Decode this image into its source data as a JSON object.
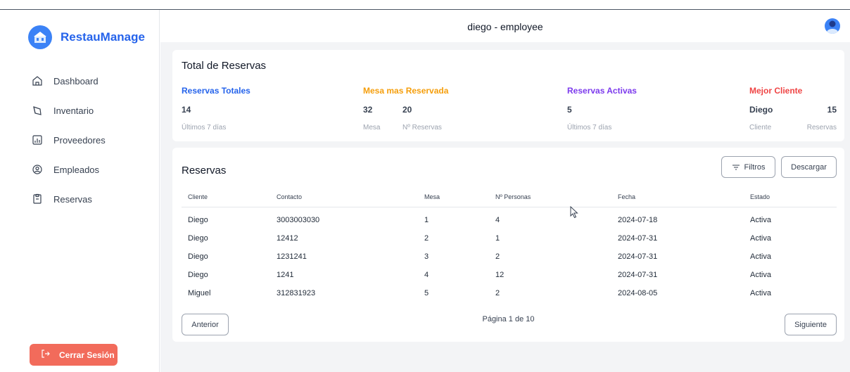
{
  "header": {
    "title": "diego - employee"
  },
  "sidebar": {
    "brand": "RestauManage",
    "items": [
      {
        "label": "Dashboard",
        "icon": "home-icon"
      },
      {
        "label": "Inventario",
        "icon": "box-icon"
      },
      {
        "label": "Proveedores",
        "icon": "chart-icon"
      },
      {
        "label": "Empleados",
        "icon": "user-icon"
      },
      {
        "label": "Reservas",
        "icon": "clipboard-icon"
      }
    ],
    "logout_label": "Cerrar Sesión"
  },
  "summary": {
    "title": "Total de Reservas",
    "total": {
      "label": "Reservas Totales",
      "value": "14",
      "sub": "Últimos 7 días",
      "color": "#2563eb"
    },
    "mesa": {
      "label": "Mesa mas Reservada",
      "mesa_value": "32",
      "reservas_value": "20",
      "mesa_sub": "Mesa",
      "reservas_sub": "Nº Reservas",
      "color": "#f59e0b"
    },
    "activas": {
      "label": "Reservas Activas",
      "value": "5",
      "sub": "Últimos 7 días",
      "color": "#7c3aed"
    },
    "cliente": {
      "label": "Mejor Cliente",
      "name": "Diego",
      "count": "15",
      "name_sub": "Cliente",
      "count_sub": "Reservas",
      "color": "#ef4444"
    }
  },
  "reservas": {
    "title": "Reservas",
    "filtros_label": "Filtros",
    "descargar_label": "Descargar",
    "columns": [
      "Cliente",
      "Contacto",
      "Mesa",
      "Nº Personas",
      "Fecha",
      "Estado"
    ],
    "rows": [
      [
        "Diego",
        "3003003030",
        "1",
        "4",
        "2024-07-18",
        "Activa"
      ],
      [
        "Diego",
        "12412",
        "2",
        "1",
        "2024-07-31",
        "Activa"
      ],
      [
        "Diego",
        "1231241",
        "3",
        "2",
        "2024-07-31",
        "Activa"
      ],
      [
        "Diego",
        "1241",
        "4",
        "12",
        "2024-07-31",
        "Activa"
      ],
      [
        "Miguel",
        "312831923",
        "5",
        "2",
        "2024-08-05",
        "Activa"
      ]
    ],
    "pagination": "Página 1 de 10",
    "anterior_label": "Anterior",
    "siguiente_label": "Siguiente"
  },
  "colors": {
    "accent": "#3b82f6",
    "logout": "#f26b5b",
    "background": "#f3f4f6"
  }
}
